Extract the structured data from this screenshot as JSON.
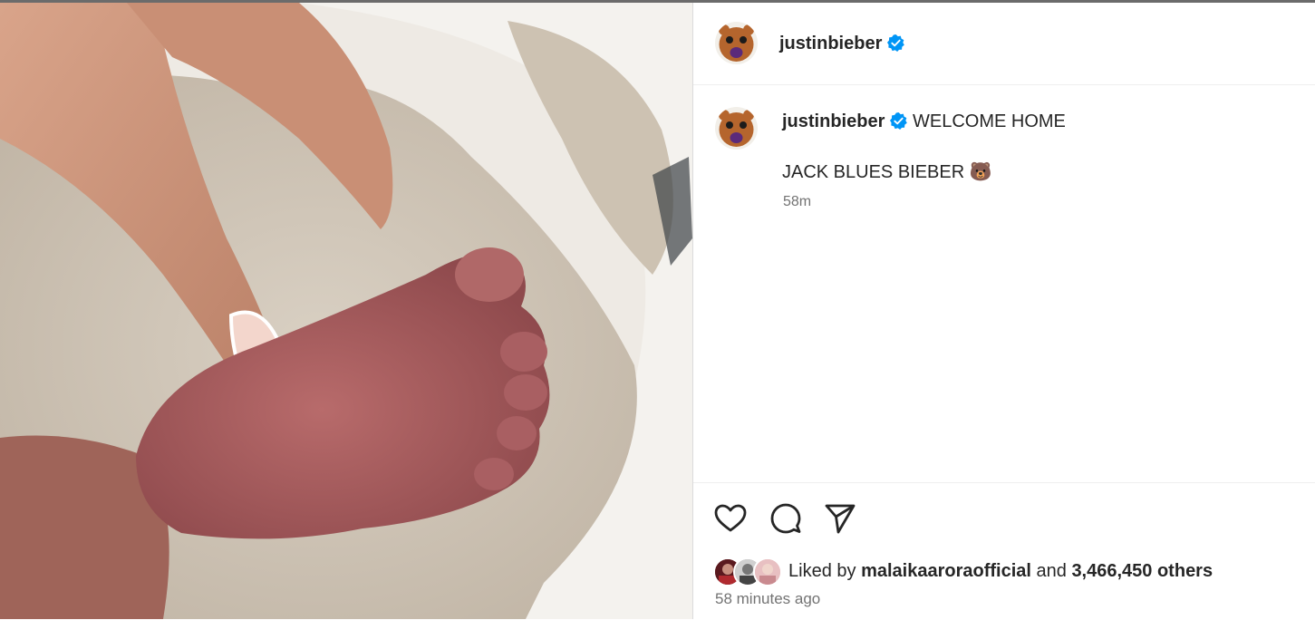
{
  "post": {
    "author": "justinbieber",
    "caption_line1": "WELCOME HOME",
    "caption_line2": "JACK BLUES BIEBER",
    "caption_emoji": "🐻",
    "time_short": "58m",
    "time_full": "58 minutes ago"
  },
  "likes": {
    "prefix": "Liked by",
    "first_liker": "malaikaaroraofficial",
    "connector": "and",
    "count_text": "3,466,450 others"
  },
  "icons": {
    "like": "heart-icon",
    "comment": "comment-icon",
    "share": "paper-plane-icon",
    "verified": "verified-badge-icon"
  },
  "colors": {
    "verified_blue": "#0095f6",
    "text_primary": "#262626",
    "text_secondary": "#737373"
  }
}
